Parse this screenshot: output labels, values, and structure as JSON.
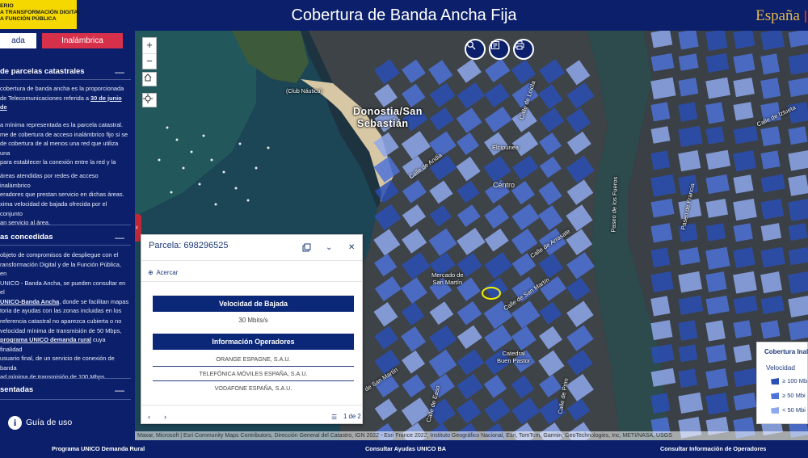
{
  "header": {
    "ministry_lines": [
      "ERIO",
      "A TRANSFORMACIÓN DIGITAL",
      "A FUNCIÓN PÚBLICA"
    ],
    "title": "Cobertura de Banda Ancha Fija",
    "brand": "España"
  },
  "tabs": {
    "fija": "ada",
    "inalambrica": "Inalámbrica"
  },
  "sidebar": {
    "section1_title": "de parcelas catastrales",
    "section1_p1": [
      "cobertura de banda ancha es la proporcionada",
      "de Telecomunicaciones referida a ",
      "30 de junio de"
    ],
    "section1_p2": [
      "a mínima representada es la parcela catastral.",
      "me de cobertura de acceso inalámbrico fijo si se",
      "de cobertura de al menos una red que utiliza una",
      "para establecer la conexión entre la red y la"
    ],
    "section1_p3": [
      "áreas atendidas por redes de acceso inalámbrico",
      "eradores que prestan servicio en dichas áreas."
    ],
    "section1_p4": [
      "xima velocidad de bajada ofrecida por el conjunto",
      "an servicio al área."
    ],
    "section2_title": "as concedidas",
    "section2_p1": [
      "objeto de compromisos de despliegue con el",
      "ransformación Digital y de la Función Pública, en",
      "UNICO - Banda Ancha, se pueden consultar en el",
      "UNICO-Banda Ancha",
      ", donde se facilitan mapas",
      "toria de ayudas con las zonas incluidas en los",
      "."
    ],
    "section2_p2": [
      "referencia catastral no aparezca cubierta o no",
      "velocidad mínima de transmisión de 50 Mbps,",
      "programa UNICO demanda rural",
      " cuya finalidad",
      "usuario final, de un servicio de conexión de banda",
      "ad mínima de transmisión de 100 Mbps."
    ],
    "section3_title": "sentadas",
    "guide_label": "Guía de uso"
  },
  "map": {
    "city": [
      "Donostia/San",
      "Sebastián"
    ],
    "labels": {
      "club": "(Club Náutico)",
      "centro": "Centro",
      "mercado": [
        "Mercado de",
        "San Martín"
      ],
      "catedral": [
        "Catedral",
        "Buen Pastor"
      ],
      "lindo": "Elcipunea",
      "calle_andia": "Calle de Andia",
      "calle_arrasate": "Calle de Arrasate",
      "calle_san_martin": "Calle de San Martín",
      "calle_loiola": "Calle de Loiola",
      "calle_sanmartin2": "de San Martín",
      "paseo_fueros": "Paseo de los Fueros",
      "paseo_francia": "Paseo de Francia",
      "calle_easo": "Calle de Easo",
      "calle_iztueta": "Calle de Iztueta",
      "calle_prim": "Calle de Prim"
    },
    "attribution": "Maxar, Microsoft | Esri Community Maps Contributors, Dirección General del Catastro, IGN 2022 - Esri France 2022, Instituto Geográfico Nacional, Esri, TomTom, Garmin, GeoTechnologies, Inc, METI/NASA, USGS"
  },
  "popup": {
    "title": "Parcela: 698296525",
    "zoom_to": "Acercar",
    "speed_header": "Velocidad de Bajada",
    "speed_value": "30 Mbits/s",
    "operators_header": "Información Operadores",
    "operators": [
      "ORANGE ESPAGNE, S.A.U.",
      "TELEFÓNICA MÓVILES ESPAÑA, S.A.U.",
      "VODAFONE ESPAÑA, S.A.U."
    ],
    "page": "1 de 2"
  },
  "legend": {
    "title": "Cobertura Inal",
    "subtitle": "Velocidad",
    "items": [
      {
        "label": "≥ 100 Mb",
        "color": "#2a4fb5"
      },
      {
        "label": "≥ 50 Mbi",
        "color": "#4d72d8"
      },
      {
        "label": "< 50 Mbi",
        "color": "#8fa8ec"
      }
    ]
  },
  "footer": {
    "link1": "Programa UNICO Demanda Rural",
    "link2": "Consultar Ayudas UNICO BA",
    "link3": "Consultar Información de Operadores"
  },
  "colors": {
    "navy": "#0b1f6b",
    "red": "#d6304a",
    "gold": "#f4d800"
  }
}
